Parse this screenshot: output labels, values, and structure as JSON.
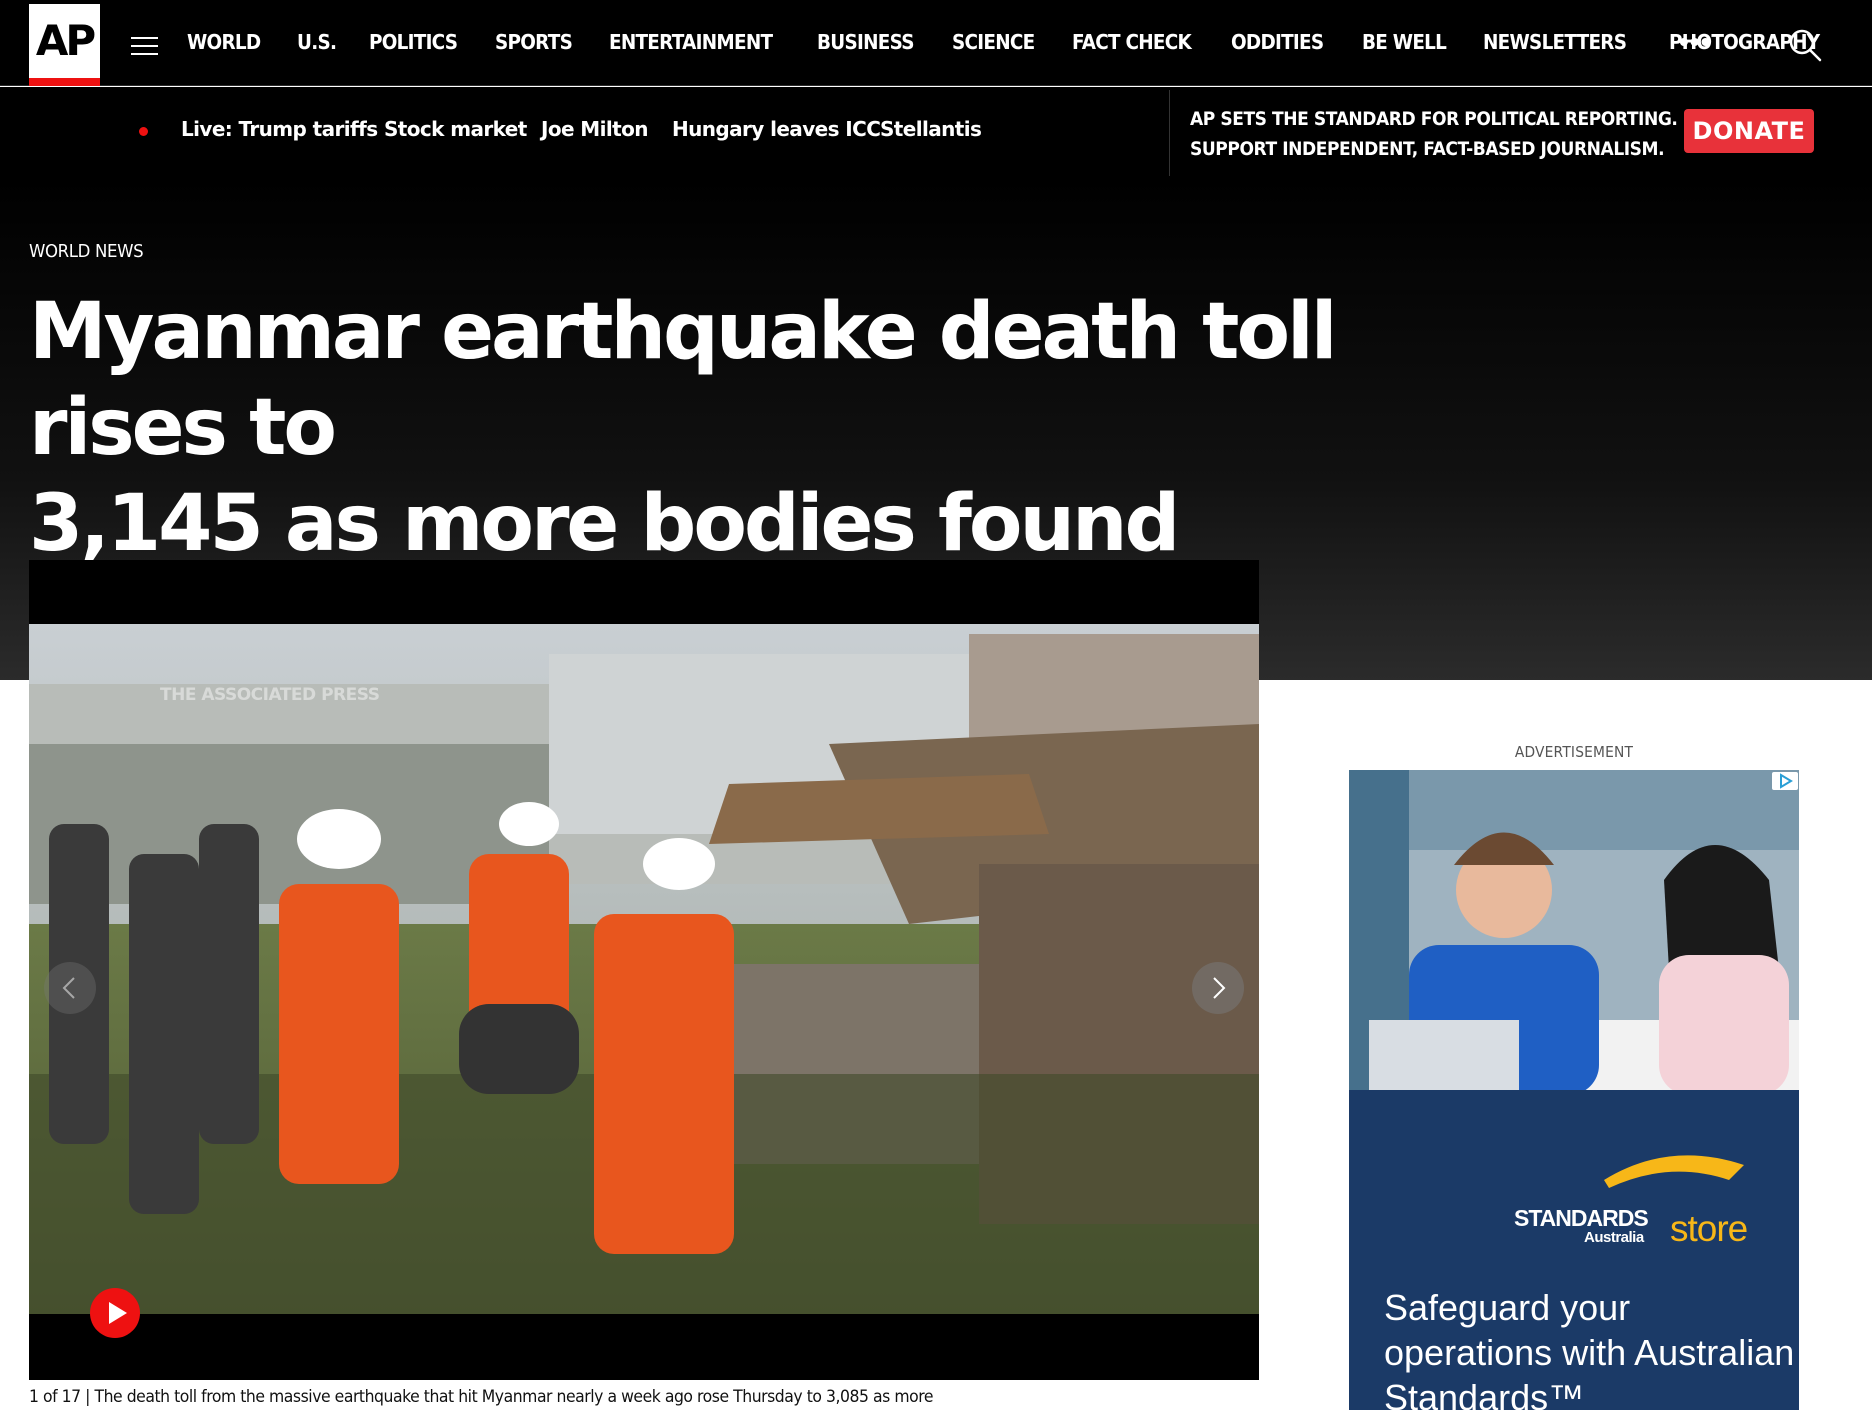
{
  "brand": {
    "logo_text": "AP"
  },
  "nav": {
    "items": [
      "WORLD",
      "U.S.",
      "POLITICS",
      "SPORTS",
      "ENTERTAINMENT",
      "BUSINESS",
      "SCIENCE",
      "FACT CHECK",
      "ODDITIES",
      "BE WELL",
      "NEWSLETTERS",
      "PHOTOGRAPHY"
    ],
    "more": "•••"
  },
  "trending": [
    "Live: Trump tariffs",
    "Stock market",
    "Joe Milton",
    "Hungary leaves ICC",
    "Stellantis"
  ],
  "support": {
    "line1": "AP SETS THE STANDARD FOR POLITICAL REPORTING.",
    "line2": "SUPPORT INDEPENDENT, FACT-BASED JOURNALISM.",
    "donate_label": "DONATE"
  },
  "article": {
    "section": "WORLD NEWS",
    "headline_line1": "Myanmar earthquake death toll rises to",
    "headline_line2": "3,145 as more bodies found"
  },
  "media": {
    "watermark": "THE ASSOCIATED PRESS",
    "counter": "1 of 17 |",
    "caption": "The death toll from the massive earthquake that hit Myanmar nearly a week ago rose Thursday to 3,085 as more"
  },
  "ad": {
    "label": "ADVERTISEMENT",
    "brand_line1": "STANDARDS",
    "brand_line2": "Australia",
    "brand_store": "store",
    "copy": "Safeguard your operations with Australian Standards™"
  },
  "colors": {
    "accent_red": "#e8323a",
    "ad_navy": "#1b3a67",
    "ad_gold": "#f7b718"
  }
}
